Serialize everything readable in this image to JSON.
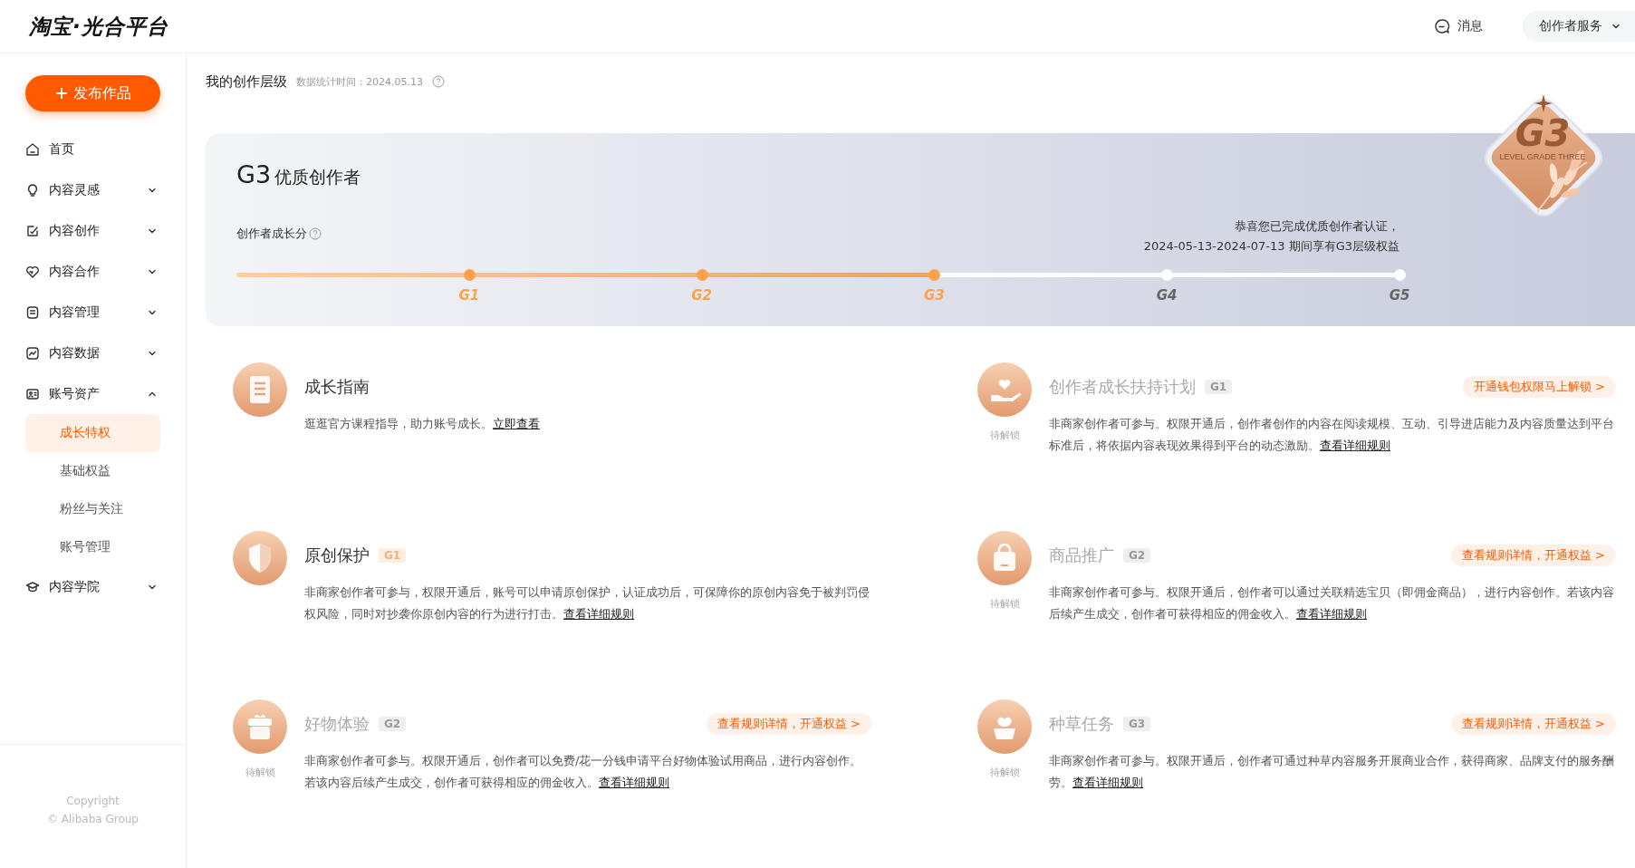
{
  "header": {
    "logo": "淘宝·光合平台",
    "messages": "消息",
    "service_menu": "创作者服务"
  },
  "sidebar": {
    "publish_button": "发布作品",
    "items": [
      {
        "label": "首页"
      },
      {
        "label": "内容灵感",
        "expandable": true,
        "expanded": false
      },
      {
        "label": "内容创作",
        "expandable": true,
        "expanded": false
      },
      {
        "label": "内容合作",
        "expandable": true,
        "expanded": false
      },
      {
        "label": "内容管理",
        "expandable": true,
        "expanded": false
      },
      {
        "label": "内容数据",
        "expandable": true,
        "expanded": false
      },
      {
        "label": "账号资产",
        "expandable": true,
        "expanded": true,
        "children": [
          {
            "label": "成长特权",
            "selected": true
          },
          {
            "label": "基础权益",
            "selected": false
          },
          {
            "label": "粉丝与关注",
            "selected": false
          },
          {
            "label": "账号管理",
            "selected": false
          }
        ]
      },
      {
        "label": "内容学院",
        "expandable": true,
        "expanded": false
      }
    ],
    "copyright": [
      "Copyright",
      "© Alibaba Group"
    ]
  },
  "page": {
    "title": "我的创作层级",
    "stat_time": "数据统计时间：2024.05.13"
  },
  "level_card": {
    "level": "G3",
    "level_name": "优质创作者",
    "score_label": "创作者成长分",
    "notice": [
      "恭喜您已完成优质创作者认证，",
      "2024-05-13-2024-07-13 期间享有G3层级权益"
    ],
    "progress": {
      "level": 0.6
    },
    "milestones": [
      {
        "label": "G1",
        "reached": true
      },
      {
        "label": "G2",
        "reached": true
      },
      {
        "label": "G3",
        "reached": true
      },
      {
        "label": "G4",
        "reached": false
      },
      {
        "label": "G5",
        "reached": false
      }
    ],
    "emblem": {
      "grade": "G3",
      "caption": "LEVEL GRADE THREE"
    }
  },
  "privileges": [
    {
      "title": "成长指南",
      "locked": false,
      "description": "逛逛官方课程指导，助力账号成长。",
      "link": "立即查看"
    },
    {
      "title": "创作者成长扶持计划",
      "badge": "G1",
      "locked": true,
      "status": "待解锁",
      "action": "开通钱包权限马上解锁 >",
      "description": "非商家创作者可参与。权限开通后，创作者创作的内容在阅读规模、互动、引导进店能力及内容质量达到平台标准后，将依据内容表现效果得到平台的动态激励。",
      "link": "查看详细规则"
    },
    {
      "title": "原创保护",
      "badge": "G1",
      "locked": false,
      "description": "非商家创作者可参与，权限开通后，账号可以申请原创保护，认证成功后，可保障你的原创内容免于被判罚侵权风险，同时对抄袭你原创内容的行为进行打击。",
      "link": "查看详细规则"
    },
    {
      "title": "商品推广",
      "badge": "G2",
      "locked": true,
      "status": "待解锁",
      "action": "查看规则详情，开通权益 >",
      "description": "非商家创作者可参与。权限开通后，创作者可以通过关联精选宝贝（即佣金商品），进行内容创作。若该内容后续产生成交，创作者可获得相应的佣金收入。",
      "link": "查看详细规则"
    },
    {
      "title": "好物体验",
      "badge": "G2",
      "locked": true,
      "status": "待解锁",
      "action": "查看规则详情，开通权益 >",
      "description": "非商家创作者可参与。权限开通后，创作者可以免费/花一分钱申请平台好物体验试用商品，进行内容创作。若该内容后续产生成交，创作者可获得相应的佣金收入。",
      "link": "查看详细规则"
    },
    {
      "title": "种草任务",
      "badge": "G3",
      "locked": true,
      "status": "待解锁",
      "action": "查看规则详情，开通权益 >",
      "description": "非商家创作者可参与。权限开通后，创作者可通过种草内容服务开展商业合作，获得商家、品牌支付的服务酬劳。",
      "link": "查看详细规则"
    }
  ]
}
